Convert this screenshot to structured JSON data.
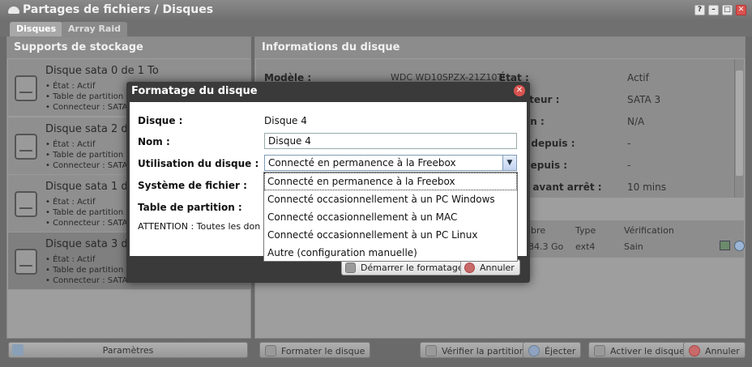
{
  "window": {
    "title": "Partages de fichiers / Disques",
    "buttons": [
      "?",
      "–",
      "□",
      "✕"
    ]
  },
  "tabs": [
    {
      "label": "Disques",
      "active": true
    },
    {
      "label": "Array Raid",
      "active": false
    }
  ],
  "left_panel": {
    "title": "Supports de stockage",
    "disks": [
      {
        "name": "Disque sata 0 de 1 To",
        "lines": [
          "• État : Actif",
          "• Table de partition",
          "• Connecteur : SATA"
        ]
      },
      {
        "name": "Disque sata 2 de",
        "lines": [
          "• État : Actif",
          "• Table de partition",
          "• Connecteur : SATA"
        ]
      },
      {
        "name": "Disque sata 1 de",
        "lines": [
          "• État : Actif",
          "• Table de partition",
          "• Connecteur : SATA"
        ]
      },
      {
        "name": "Disque sata 3 de",
        "lines": [
          "• État : Actif",
          "• Table de partition",
          "• Connecteur : SATA"
        ]
      }
    ],
    "params_button": "Paramètres"
  },
  "right_panel": {
    "title": "Informations du disque",
    "model_label": "Modèle :",
    "model_value": "WDC WD10SPZX-21Z10T0",
    "fields": [
      {
        "label": "État :",
        "value": "Actif"
      },
      {
        "label": "cteur :",
        "value": "SATA 3"
      },
      {
        "label": "on :",
        "value": "N/A"
      },
      {
        "label": "f depuis :",
        "value": "-"
      },
      {
        "label": "depuis :",
        "value": "-"
      },
      {
        "label": "s avant arrêt :",
        "value": "10 mins"
      }
    ],
    "partition_table": {
      "headers": [
        "ibre",
        "Type",
        "Vérification"
      ],
      "row": [
        "84.3 Go",
        "ext4",
        "Sain"
      ]
    }
  },
  "bottom_buttons": {
    "format": "Formater le disque",
    "verify": "Vérifier la partition",
    "eject": "Éjecter",
    "activate": "Activer le disque",
    "cancel": "Annuler"
  },
  "modal": {
    "title": "Formatage du disque",
    "disk_label": "Disque :",
    "disk_value": "Disque 4",
    "name_label": "Nom :",
    "name_value": "Disque 4",
    "usage_label": "Utilisation du disque :",
    "usage_value": "Connecté en permanence à la Freebox",
    "fs_label": "Système de fichier :",
    "pt_label": "Table de partition :",
    "warning": "ATTENTION : Toutes les don",
    "start_button": "Démarrer le formatage",
    "cancel_button": "Annuler",
    "usage_options": [
      "Connecté en permanence à la Freebox",
      "Connecté occasionnellement à un PC Windows",
      "Connecté occasionnellement à un MAC",
      "Connecté occasionnellement à un PC Linux",
      "Autre (configuration manuelle)"
    ]
  },
  "colors": {
    "modal_header": "#3a3a3a",
    "close_red": "#d9534f",
    "panel_gray": "#9e9e9e"
  }
}
